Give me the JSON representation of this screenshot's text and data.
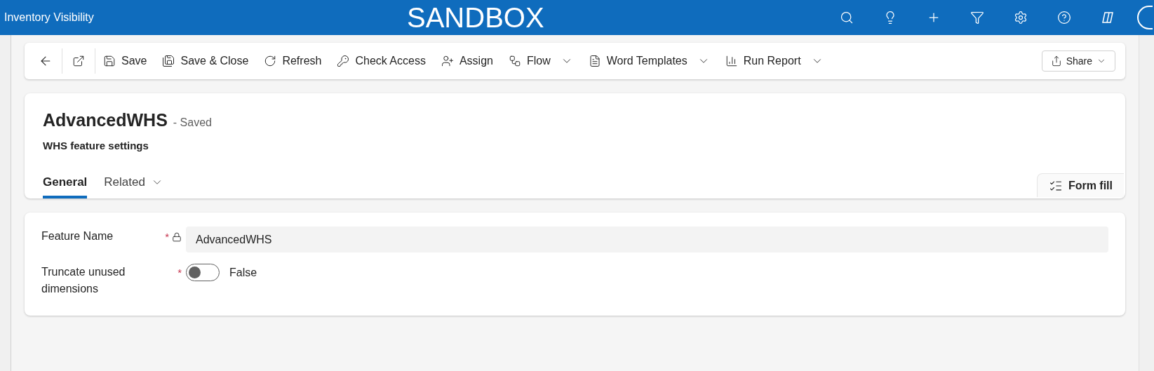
{
  "app_bar": {
    "title": "Inventory Visibility",
    "environment": "SANDBOX"
  },
  "command_bar": {
    "commands": [
      {
        "label": "Save",
        "has_menu": false
      },
      {
        "label": "Save & Close",
        "has_menu": false
      },
      {
        "label": "Refresh",
        "has_menu": false
      },
      {
        "label": "Check Access",
        "has_menu": false
      },
      {
        "label": "Assign",
        "has_menu": false
      },
      {
        "label": "Flow",
        "has_menu": true
      },
      {
        "label": "Word Templates",
        "has_menu": true
      },
      {
        "label": "Run Report",
        "has_menu": true
      }
    ],
    "share": "Share"
  },
  "record": {
    "title": "AdvancedWHS",
    "status": "- Saved",
    "subtitle": "WHS feature settings",
    "tabs": [
      {
        "label": "General",
        "selected": true,
        "has_menu": false
      },
      {
        "label": "Related",
        "selected": false,
        "has_menu": true
      }
    ],
    "form_fill": "Form fill"
  },
  "fields": [
    {
      "kind": "text",
      "label": "Feature Name",
      "required_mark": "*",
      "locked": true,
      "value": "AdvancedWHS"
    },
    {
      "kind": "toggle",
      "label": "Truncate unused dimensions",
      "required_mark": "*",
      "locked": false,
      "on": false,
      "value_text": "False"
    }
  ]
}
